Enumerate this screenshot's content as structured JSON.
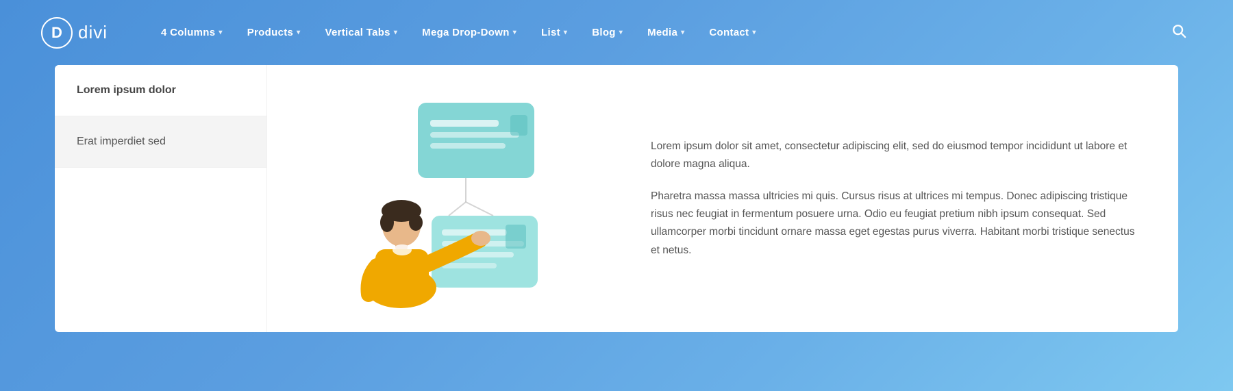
{
  "logo": {
    "letter": "D",
    "text": "divi"
  },
  "nav": {
    "items": [
      {
        "label": "4 Columns",
        "has_dropdown": true
      },
      {
        "label": "Products",
        "has_dropdown": true
      },
      {
        "label": "Vertical Tabs",
        "has_dropdown": true
      },
      {
        "label": "Mega Drop-Down",
        "has_dropdown": true
      },
      {
        "label": "List",
        "has_dropdown": true
      },
      {
        "label": "Blog",
        "has_dropdown": true
      },
      {
        "label": "Media",
        "has_dropdown": true
      },
      {
        "label": "Contact",
        "has_dropdown": true
      }
    ],
    "search_icon": "🔍"
  },
  "card": {
    "sidebar": {
      "items": [
        {
          "label": "Lorem ipsum dolor",
          "state": "active"
        },
        {
          "label": "Erat imperdiet sed",
          "state": "highlighted"
        }
      ]
    },
    "text_blocks": [
      "Lorem ipsum dolor sit amet, consectetur adipiscing elit, sed do eiusmod tempor incididunt ut labore et dolore magna aliqua.",
      "Pharetra massa massa ultricies mi quis. Cursus risus at ultrices mi tempus. Donec adipiscing tristique risus nec feugiat in fermentum posuere urna. Odio eu feugiat pretium nibh ipsum consequat. Sed ullamcorper morbi tincidunt ornare massa eget egestas purus viverra. Habitant morbi tristique senectus et netus."
    ]
  }
}
